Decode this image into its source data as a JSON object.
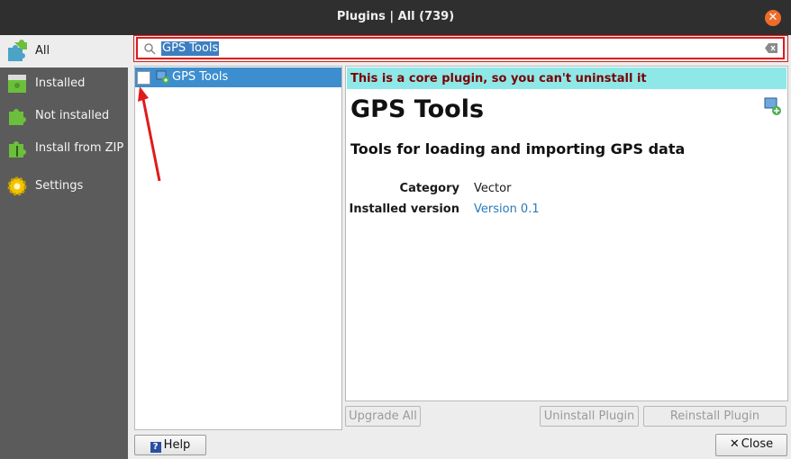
{
  "window": {
    "title": "Plugins | All (739)"
  },
  "sidebar": {
    "items": [
      {
        "label": "All",
        "icon": "puzzle-all-icon"
      },
      {
        "label": "Installed",
        "icon": "puzzle-installed-icon"
      },
      {
        "label": "Not installed",
        "icon": "puzzle-not-installed-icon"
      },
      {
        "label": "Install from ZIP",
        "icon": "puzzle-zip-icon"
      },
      {
        "label": "Settings",
        "icon": "gear-icon"
      }
    ]
  },
  "search": {
    "value": "GPS Tools"
  },
  "plugin_list": [
    {
      "name": "GPS Tools",
      "checked": false,
      "selected": true
    }
  ],
  "detail": {
    "banner": "This is a core plugin, so you can't uninstall it",
    "name": "GPS Tools",
    "description": "Tools for loading and importing GPS data",
    "category_label": "Category",
    "category_value": "Vector",
    "version_label": "Installed version",
    "version_value": "Version 0.1"
  },
  "buttons": {
    "upgrade_all": "Upgrade All",
    "uninstall": "Uninstall Plugin",
    "reinstall": "Reinstall Plugin",
    "help": "Help",
    "close": "Close"
  },
  "colors": {
    "accent": "#3d8ecf",
    "banner_bg": "#8fe8e8",
    "banner_text": "#7a0000",
    "highlight_border": "#e01b1b",
    "link": "#2a7ab8"
  }
}
